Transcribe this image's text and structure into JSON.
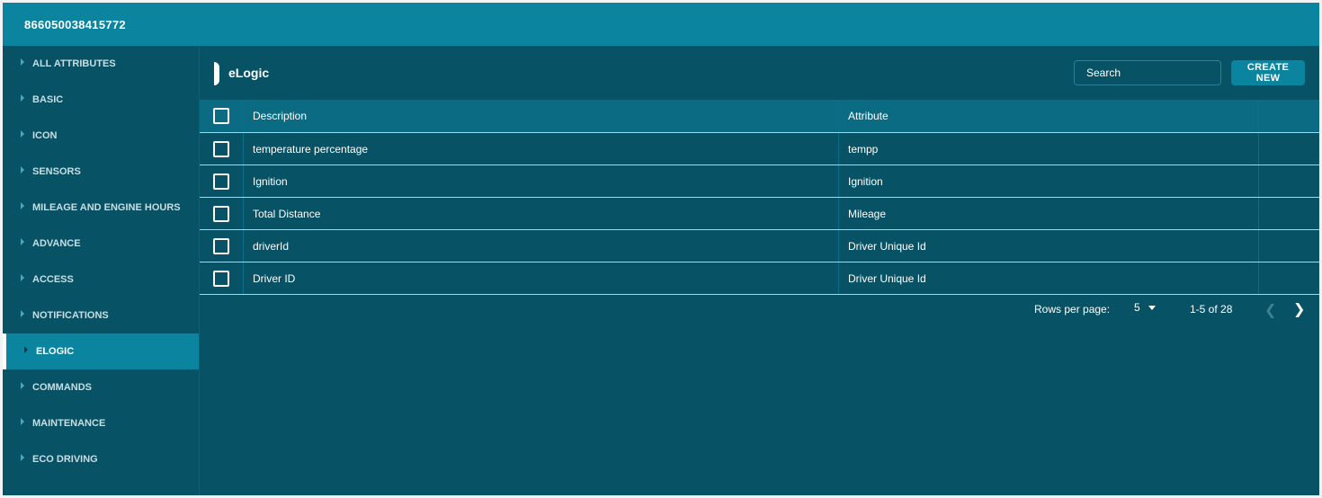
{
  "window": {
    "title": "866050038415772"
  },
  "sidebar": {
    "items": [
      {
        "label": "ALL ATTRIBUTES"
      },
      {
        "label": "BASIC"
      },
      {
        "label": "ICON"
      },
      {
        "label": "SENSORS"
      },
      {
        "label": "MILEAGE AND ENGINE HOURS"
      },
      {
        "label": "ADVANCE"
      },
      {
        "label": "ACCESS"
      },
      {
        "label": "NOTIFICATIONS"
      },
      {
        "label": "ELOGIC",
        "active": true
      },
      {
        "label": "COMMANDS"
      },
      {
        "label": "MAINTENANCE"
      },
      {
        "label": "ECO DRIVING"
      }
    ]
  },
  "main": {
    "title": "eLogic",
    "search": {
      "placeholder": "Search",
      "value": ""
    },
    "create_label": "CREATE NEW"
  },
  "table": {
    "columns": [
      "Description",
      "Attribute"
    ],
    "rows": [
      {
        "description": "temperature percentage",
        "attribute": "tempp"
      },
      {
        "description": "Ignition",
        "attribute": "Ignition"
      },
      {
        "description": "Total Distance",
        "attribute": "Mileage"
      },
      {
        "description": "driverId",
        "attribute": "Driver Unique Id"
      },
      {
        "description": "Driver ID",
        "attribute": "Driver Unique Id"
      }
    ]
  },
  "pagination": {
    "rows_per_page_label": "Rows per page:",
    "rows_per_page": "5",
    "range": "1-5 of 28",
    "prev_icon": "chevron-left-icon",
    "next_icon": "chevron-right-icon"
  },
  "colors": {
    "titlebar": "#0b849f",
    "background": "#075264",
    "active": "#0b849f"
  }
}
